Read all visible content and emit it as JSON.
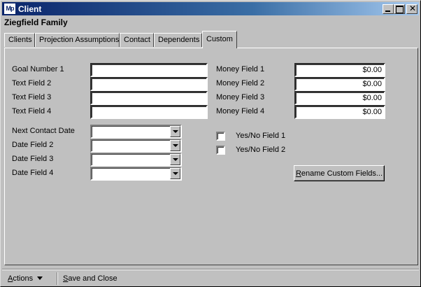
{
  "window": {
    "title": "Client",
    "icon_label": "Mp",
    "family_name": "Ziegfield Family"
  },
  "tabs": [
    {
      "label": "Clients"
    },
    {
      "label": "Projection Assumptions"
    },
    {
      "label": "Contact"
    },
    {
      "label": "Dependents"
    },
    {
      "label": "Custom",
      "active": true
    }
  ],
  "text_fields": [
    {
      "label": "Goal Number 1",
      "value": ""
    },
    {
      "label": "Text Field 2",
      "value": ""
    },
    {
      "label": "Text Field 3",
      "value": ""
    },
    {
      "label": "Text Field 4",
      "value": ""
    }
  ],
  "money_fields": [
    {
      "label": "Money Field 1",
      "value": "$0.00"
    },
    {
      "label": "Money Field 2",
      "value": "$0.00"
    },
    {
      "label": "Money Field 3",
      "value": "$0.00"
    },
    {
      "label": "Money Field 4",
      "value": "$0.00"
    }
  ],
  "date_fields": [
    {
      "label": "Next Contact Date",
      "value": ""
    },
    {
      "label": "Date Field 2",
      "value": ""
    },
    {
      "label": "Date Field 3",
      "value": ""
    },
    {
      "label": "Date Field 4",
      "value": ""
    }
  ],
  "checkboxes": [
    {
      "label": "Yes/No Field 1",
      "checked": false
    },
    {
      "label": "Yes/No Field 2",
      "checked": false
    }
  ],
  "rename_button": {
    "mnemonic": "R",
    "rest": "ename Custom Fields..."
  },
  "statusbar": {
    "actions_mnemonic": "A",
    "actions_rest": "ctions",
    "save_mnemonic": "S",
    "save_rest": "ave and Close"
  }
}
